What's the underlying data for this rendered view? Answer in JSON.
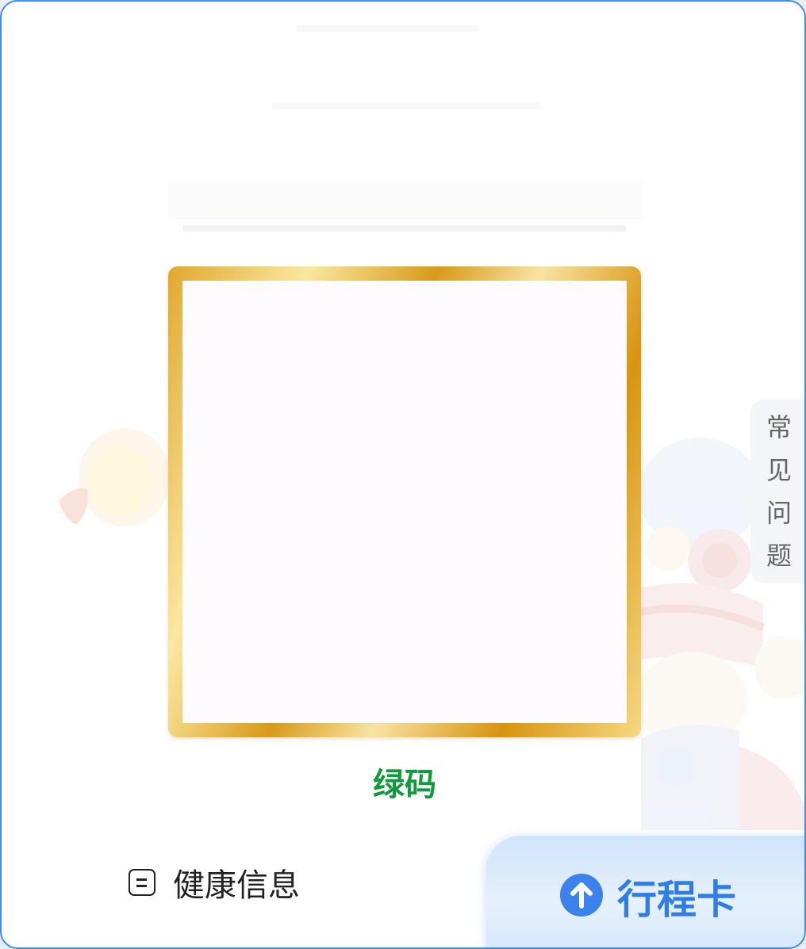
{
  "qr": {
    "status_label": "绿码",
    "status_color": "#0f9a3c",
    "frame_color": "gold-gradient"
  },
  "faq_tab": {
    "chars": [
      "常",
      "见",
      "问",
      "题"
    ]
  },
  "bottom_tabs": {
    "health_label": "健康信息",
    "health_icon": "document-icon",
    "trip_label": "行程卡",
    "trip_icon": "arrow-up-circle-icon"
  },
  "colors": {
    "accent": "#3b82ee",
    "border": "#3f8df0"
  }
}
